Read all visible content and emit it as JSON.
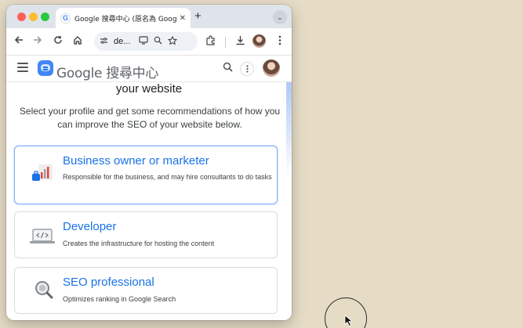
{
  "browser": {
    "tab_title": "Google 搜尋中心 (原名為 Goog",
    "tab_favicon": "G",
    "tab_close": "✕",
    "new_tab": "+",
    "tab_menu": "⌄",
    "url_text": "de...",
    "icons": [
      "back-icon",
      "forward-icon",
      "reload-icon",
      "home-icon",
      "site-info-icon",
      "cast-icon",
      "zoom-icon",
      "bookmark-star-icon",
      "extensions-icon",
      "download-icon",
      "profile-avatar",
      "menu-icon"
    ]
  },
  "site_header": {
    "logo_text": "Google 搜尋中心"
  },
  "content": {
    "heading": "your website",
    "intro": "Select your profile and get some recommendations of how you can improve the SEO of your website below.",
    "cards": [
      {
        "title": "Business owner or marketer",
        "description": "Responsible for the business, and may hire consultants to do tasks",
        "icon": "business-chart-icon"
      },
      {
        "title": "Developer",
        "description": "Creates the infrastructure for hosting the content",
        "icon": "laptop-code-icon"
      },
      {
        "title": "SEO professional",
        "description": "Optimizes ranking in Google Search",
        "icon": "magnifier-icon"
      }
    ]
  },
  "colors": {
    "desktop": "#e6dcc6",
    "link_blue": "#1a73e8",
    "selected_border": "#8ab4f8"
  }
}
